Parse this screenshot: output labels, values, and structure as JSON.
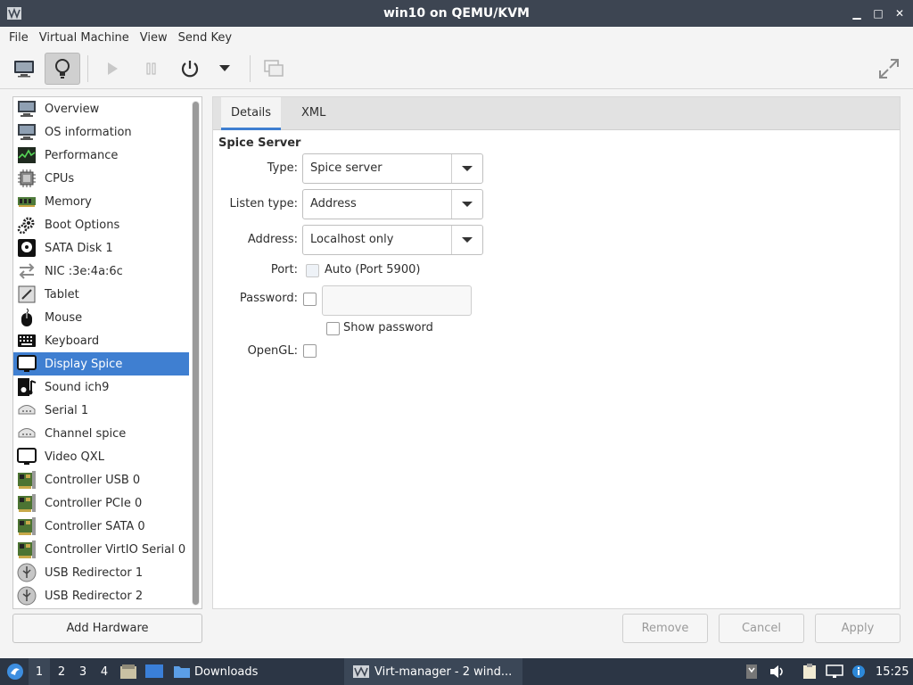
{
  "window": {
    "title": "win10 on QEMU/KVM",
    "controls": [
      "minimize-icon",
      "maximize-icon",
      "close-icon"
    ]
  },
  "menu": [
    "File",
    "Virtual Machine",
    "View",
    "Send Key"
  ],
  "toolbar": {
    "buttons": [
      "console-icon",
      "details-lightbulb-icon",
      "play-icon",
      "pause-icon",
      "power-icon",
      "dropdown-icon",
      "screenshot-icon",
      "fullscreen-icon"
    ]
  },
  "sidebar": {
    "items": [
      {
        "label": "Overview",
        "icon": "monitor-icon"
      },
      {
        "label": "OS information",
        "icon": "monitor-icon"
      },
      {
        "label": "Performance",
        "icon": "performance-icon"
      },
      {
        "label": "CPUs",
        "icon": "cpu-icon"
      },
      {
        "label": "Memory",
        "icon": "memory-icon"
      },
      {
        "label": "Boot Options",
        "icon": "gears-icon"
      },
      {
        "label": "SATA Disk 1",
        "icon": "disk-icon"
      },
      {
        "label": "NIC :3e:4a:6c",
        "icon": "network-arrows-icon"
      },
      {
        "label": "Tablet",
        "icon": "tablet-icon"
      },
      {
        "label": "Mouse",
        "icon": "mouse-icon"
      },
      {
        "label": "Keyboard",
        "icon": "keyboard-icon"
      },
      {
        "label": "Display Spice",
        "icon": "display-icon",
        "selected": true
      },
      {
        "label": "Sound ich9",
        "icon": "sound-icon"
      },
      {
        "label": "Serial 1",
        "icon": "serial-icon"
      },
      {
        "label": "Channel spice",
        "icon": "serial-icon"
      },
      {
        "label": "Video QXL",
        "icon": "display-icon"
      },
      {
        "label": "Controller USB 0",
        "icon": "controller-card-icon"
      },
      {
        "label": "Controller PCIe 0",
        "icon": "controller-card-icon"
      },
      {
        "label": "Controller SATA 0",
        "icon": "controller-card-icon"
      },
      {
        "label": "Controller VirtIO Serial 0",
        "icon": "controller-card-icon"
      },
      {
        "label": "USB Redirector 1",
        "icon": "usb-icon"
      },
      {
        "label": "USB Redirector 2",
        "icon": "usb-icon"
      }
    ],
    "add_hardware": "Add Hardware"
  },
  "tabs": [
    "Details",
    "XML"
  ],
  "form": {
    "section": "Spice Server",
    "type_label": "Type:",
    "type_value": "Spice server",
    "listen_label": "Listen type:",
    "listen_value": "Address",
    "address_label": "Address:",
    "address_value": "Localhost only",
    "port_label": "Port:",
    "port_auto": "Auto (Port 5900)",
    "password_label": "Password:",
    "password_value": "",
    "show_password": "Show password",
    "opengl_label": "OpenGL:"
  },
  "actions": {
    "remove": "Remove",
    "cancel": "Cancel",
    "apply": "Apply"
  },
  "taskbar": {
    "workspaces": [
      "1",
      "2",
      "3",
      "4"
    ],
    "folder": "Downloads",
    "window": "Virt-manager - 2 wind...",
    "clock": "15:25"
  },
  "colors": {
    "selection": "#3f7fd1",
    "titlebar": "#3d4552",
    "taskbar": "#2c3645"
  }
}
